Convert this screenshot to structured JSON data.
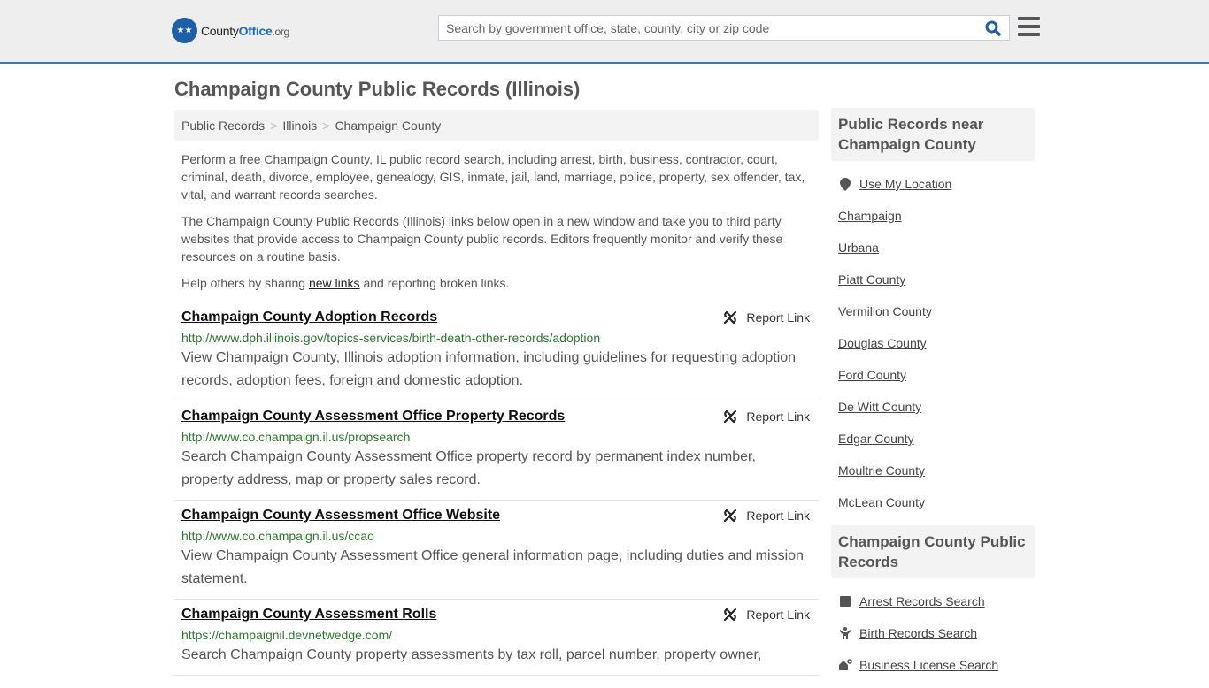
{
  "header": {
    "logo": {
      "county": "County",
      "office": "Office",
      "org": ".org"
    },
    "search_placeholder": "Search by government office, state, county, city or zip code"
  },
  "page_title": "Champaign County Public Records (Illinois)",
  "breadcrumb": [
    "Public Records",
    "Illinois",
    "Champaign County"
  ],
  "intro": {
    "p1": "Perform a free Champaign County, IL public record search, including arrest, birth, business, contractor, court, criminal, death, divorce, employee, genealogy, GIS, inmate, jail, land, marriage, police, property, sex offender, tax, vital, and warrant records searches.",
    "p2": "The Champaign County Public Records (Illinois) links below open in a new window and take you to third party websites that provide access to Champaign County public records. Editors frequently monitor and verify these resources on a routine basis.",
    "p3_before": "Help others by sharing ",
    "p3_link": "new links",
    "p3_after": " and reporting broken links."
  },
  "report_label": "Report Link",
  "records": [
    {
      "title": "Champaign County Adoption Records",
      "url": "http://www.dph.illinois.gov/topics-services/birth-death-other-records/adoption",
      "desc": "View Champaign County, Illinois adoption information, including guidelines for requesting adoption records, adoption fees, foreign and domestic adoption."
    },
    {
      "title": "Champaign County Assessment Office Property Records",
      "url": "http://www.co.champaign.il.us/propsearch",
      "desc": "Search Champaign County Assessment Office property record by permanent index number, property address, map or property sales record."
    },
    {
      "title": "Champaign County Assessment Office Website",
      "url": "http://www.co.champaign.il.us/ccao",
      "desc": "View Champaign County Assessment Office general information page, including duties and mission statement."
    },
    {
      "title": "Champaign County Assessment Rolls",
      "url": "https://champaignil.devnetwedge.com/",
      "desc": "Search Champaign County property assessments by tax roll, parcel number, property owner,"
    }
  ],
  "sidebar": {
    "near_title": "Public Records near Champaign County",
    "use_location": "Use My Location",
    "near_items": [
      "Champaign",
      "Urbana",
      "Piatt County",
      "Vermilion County",
      "Douglas County",
      "Ford County",
      "De Witt County",
      "Edgar County",
      "Moultrie County",
      "McLean County"
    ],
    "county_title": "Champaign County Public Records",
    "county_items": [
      {
        "label": "Arrest Records Search",
        "icon": "square-icon"
      },
      {
        "label": "Birth Records Search",
        "icon": "child-icon"
      },
      {
        "label": "Business License Search",
        "icon": "business-icon"
      }
    ]
  }
}
